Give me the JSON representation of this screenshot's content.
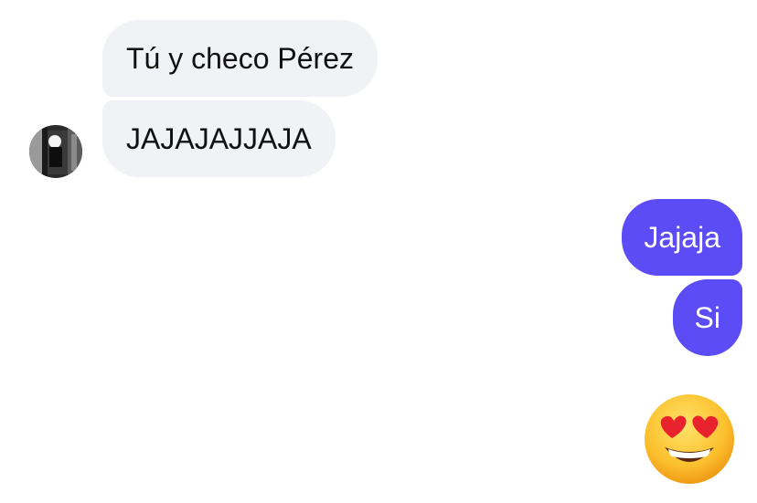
{
  "conversation": {
    "incoming": [
      {
        "text": "Tú y checo Pérez"
      },
      {
        "text": "JAJAJAJJAJA"
      }
    ],
    "outgoing": [
      {
        "text": "Jajaja"
      },
      {
        "text": "Si"
      }
    ],
    "reaction_emoji": "smiling-face-with-heart-eyes-icon"
  },
  "colors": {
    "incoming_bubble": "#f1f2f5",
    "outgoing_bubble": "#5b4cf5",
    "incoming_text": "#111111",
    "outgoing_text": "#ffffff"
  }
}
